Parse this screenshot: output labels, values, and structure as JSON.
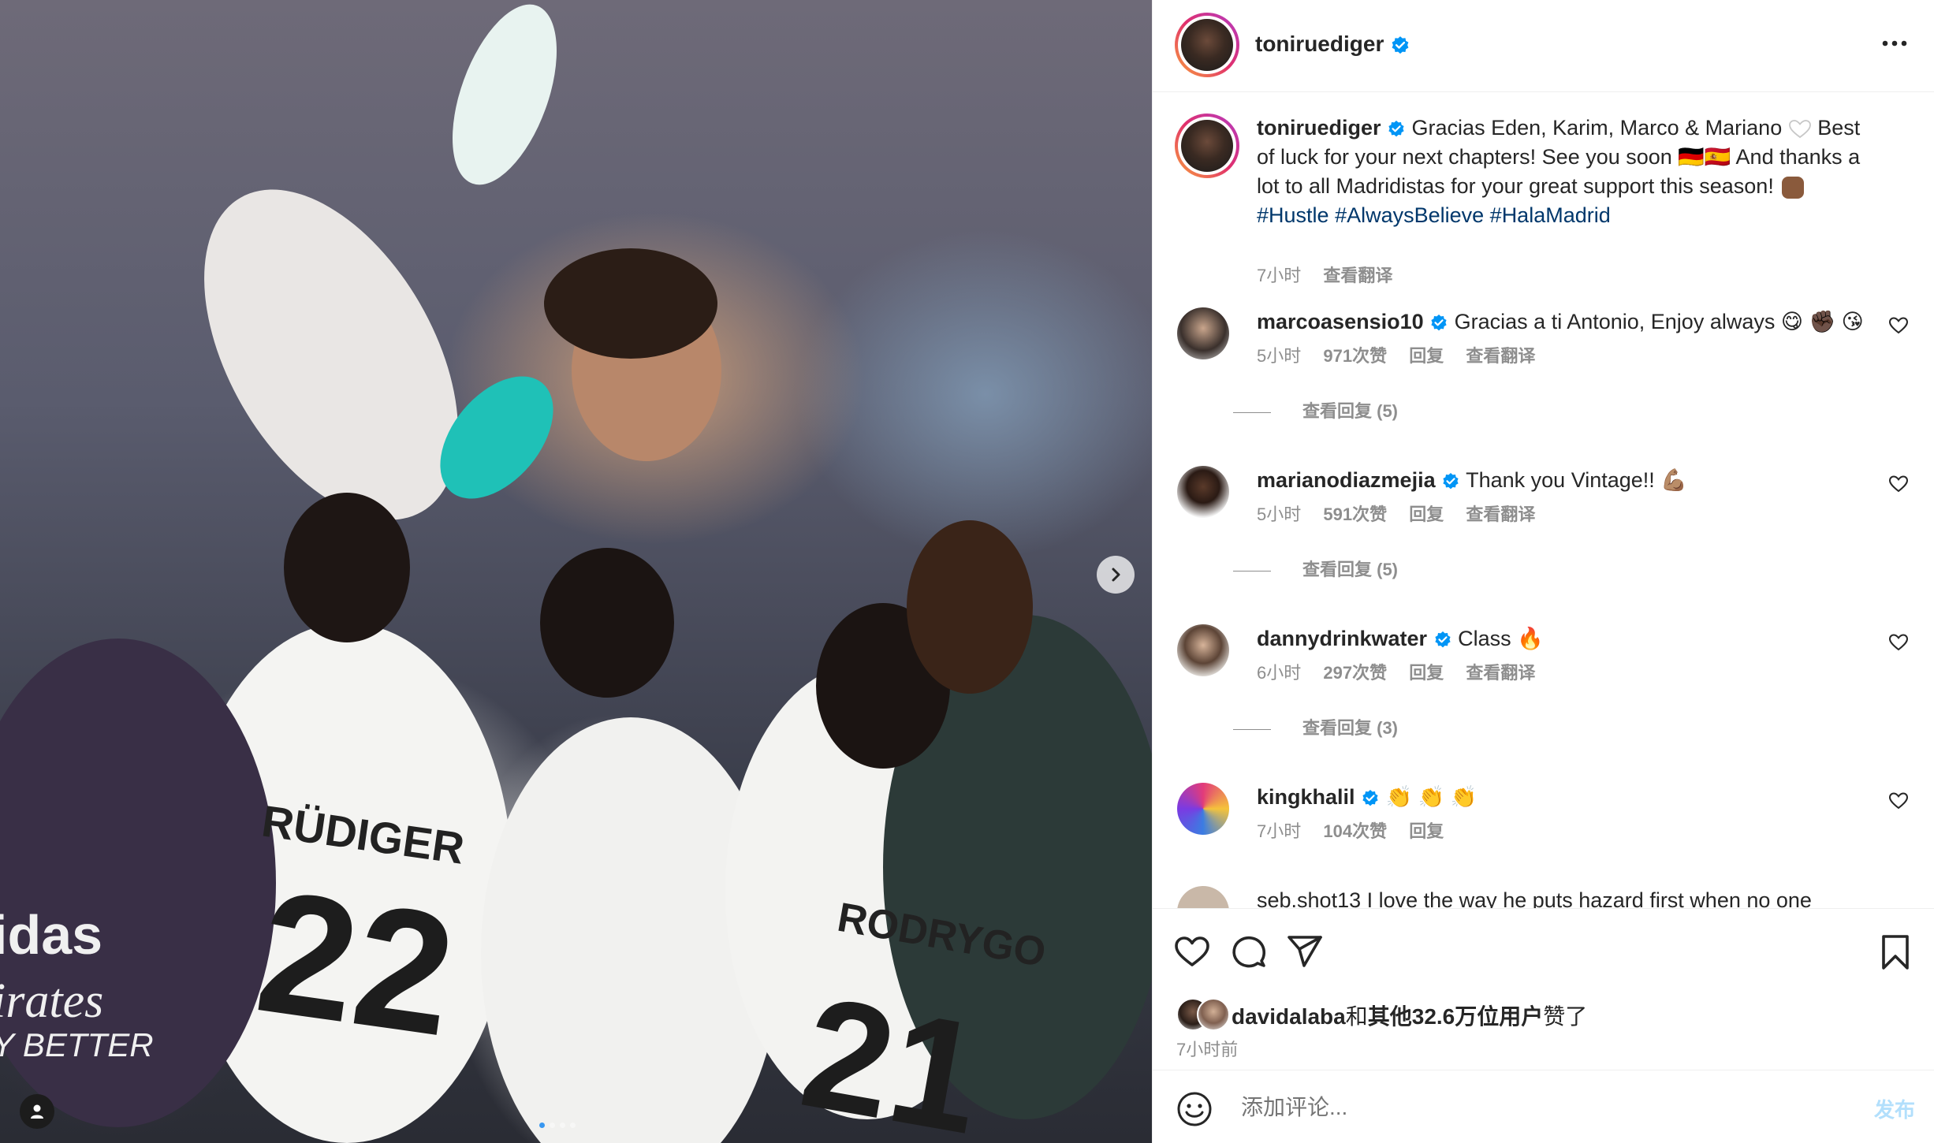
{
  "post": {
    "author": "toniruediger",
    "more_icon": "more-horizontal-icon",
    "caption": {
      "username": "toniruediger",
      "text_part1": "Gracias Eden, Karim, Marco & Mariano",
      "text_part2": "Best of luck for your next chapters! See you soon 🇩🇪🇪🇸 And thanks a lot to all Madridistas for your great support this season!",
      "hashtag1": "#Hustle",
      "hashtag2": "#AlwaysBelieve",
      "hashtag3": "#HalaMadrid",
      "time": "7小时",
      "translate": "查看翻译"
    },
    "photo": {
      "next_icon": "chevron-right-icon",
      "tag_icon": "user-tag-icon",
      "carousel_count": 4,
      "carousel_active": 1
    }
  },
  "comments": [
    {
      "username": "marcoasensio10",
      "text": "Gracias a ti Antonio, Enjoy always",
      "emojis": "😋 ✊🏿 😘",
      "time": "5小时",
      "likes": "971次赞",
      "reply": "回复",
      "translate": "查看翻译",
      "view_replies": "查看回复 (5)"
    },
    {
      "username": "marianodiazmejia",
      "text": "Thank you Vintage!!",
      "emojis": "💪🏽",
      "time": "5小时",
      "likes": "591次赞",
      "reply": "回复",
      "translate": "查看翻译",
      "view_replies": "查看回复 (5)"
    },
    {
      "username": "dannydrinkwater",
      "text": "Class",
      "emojis": "🔥",
      "time": "6小时",
      "likes": "297次赞",
      "reply": "回复",
      "translate": "查看翻译",
      "view_replies": "查看回复 (3)"
    },
    {
      "username": "kingkhalil",
      "text": "",
      "emojis": "👏 👏 👏",
      "time": "7小时",
      "likes": "104次赞",
      "reply": "回复"
    }
  ],
  "partial_comment": "seb.shot13  I love the way he puts hazard first when no one",
  "actions": {
    "like_icon": "heart-icon",
    "comment_icon": "comment-icon",
    "share_icon": "send-icon",
    "save_icon": "bookmark-icon"
  },
  "likes": {
    "user": "davidalaba",
    "joiner": "和",
    "others": "其他32.6万位用户",
    "suffix": "赞了",
    "time": "7小时前"
  },
  "composer": {
    "emoji_icon": "smiley-icon",
    "placeholder": "添加评论...",
    "post_label": "发布"
  },
  "colors": {
    "link": "#00376b",
    "verified": "#0095f6",
    "muted": "#8e8e8e",
    "post_disabled": "#b2dffc"
  }
}
